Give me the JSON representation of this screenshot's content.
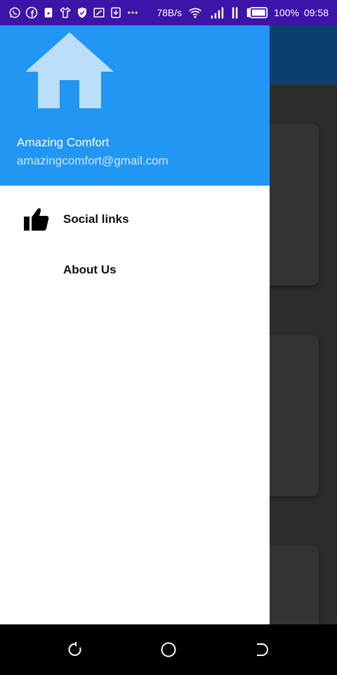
{
  "status_bar": {
    "notification_icons": [
      "whatsapp-icon",
      "facebook-icon",
      "storage-icon",
      "shirt-icon",
      "shield-icon",
      "cast-icon",
      "download-icon",
      "more-icon"
    ],
    "net_speed": "78B/s",
    "battery": "100%",
    "time": "09:58"
  },
  "drawer": {
    "header": {
      "icon": "home-icon",
      "name": "Amazing Comfort",
      "email": "amazingcomfort@gmail.com",
      "bg_color": "#2196f3"
    },
    "items": [
      {
        "label": "Social links",
        "icon": "thumbs-up-icon"
      },
      {
        "label": "About Us",
        "icon": ""
      }
    ]
  },
  "nav_bar": {
    "buttons": [
      "recent-apps",
      "home",
      "back"
    ]
  }
}
